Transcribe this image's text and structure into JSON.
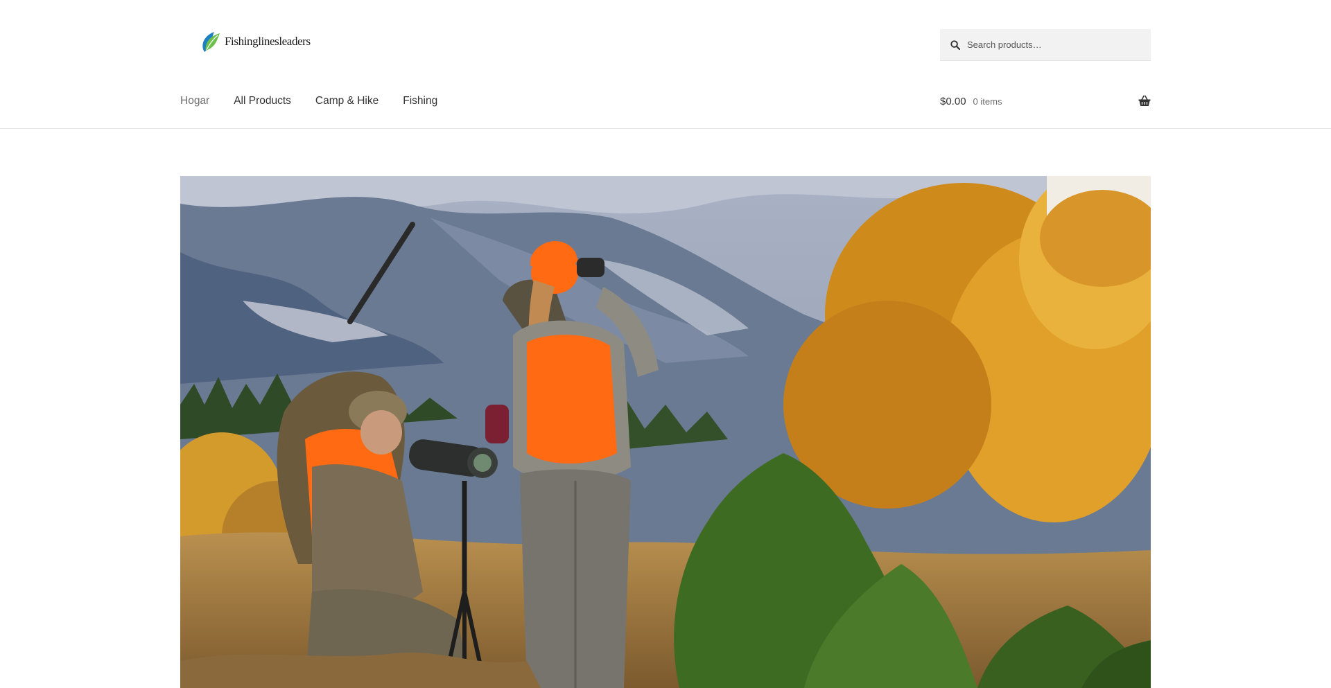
{
  "site": {
    "logo_text": "Fishinglinesleaders",
    "brand_colors": {
      "leaf_green": "#6cc04a",
      "leaf_blue": "#1e7fc2"
    }
  },
  "search": {
    "placeholder": "Search products…",
    "icon": "search-icon"
  },
  "nav": {
    "items": [
      {
        "label": "Hogar",
        "current": true
      },
      {
        "label": "All Products",
        "current": false
      },
      {
        "label": "Camp & Hike",
        "current": false
      },
      {
        "label": "Fishing",
        "current": false
      }
    ]
  },
  "cart": {
    "amount": "$0.00",
    "count": "0 items",
    "icon": "basket-icon"
  },
  "hero": {
    "image": "hunters-spotting-scope-autumn-mountains",
    "palette": {
      "sky": "#8d97ad",
      "mountain": "#5d6e86",
      "foliage": "#d9901e",
      "pine": "#3f6a22",
      "blaze": "#ff6a13"
    }
  }
}
